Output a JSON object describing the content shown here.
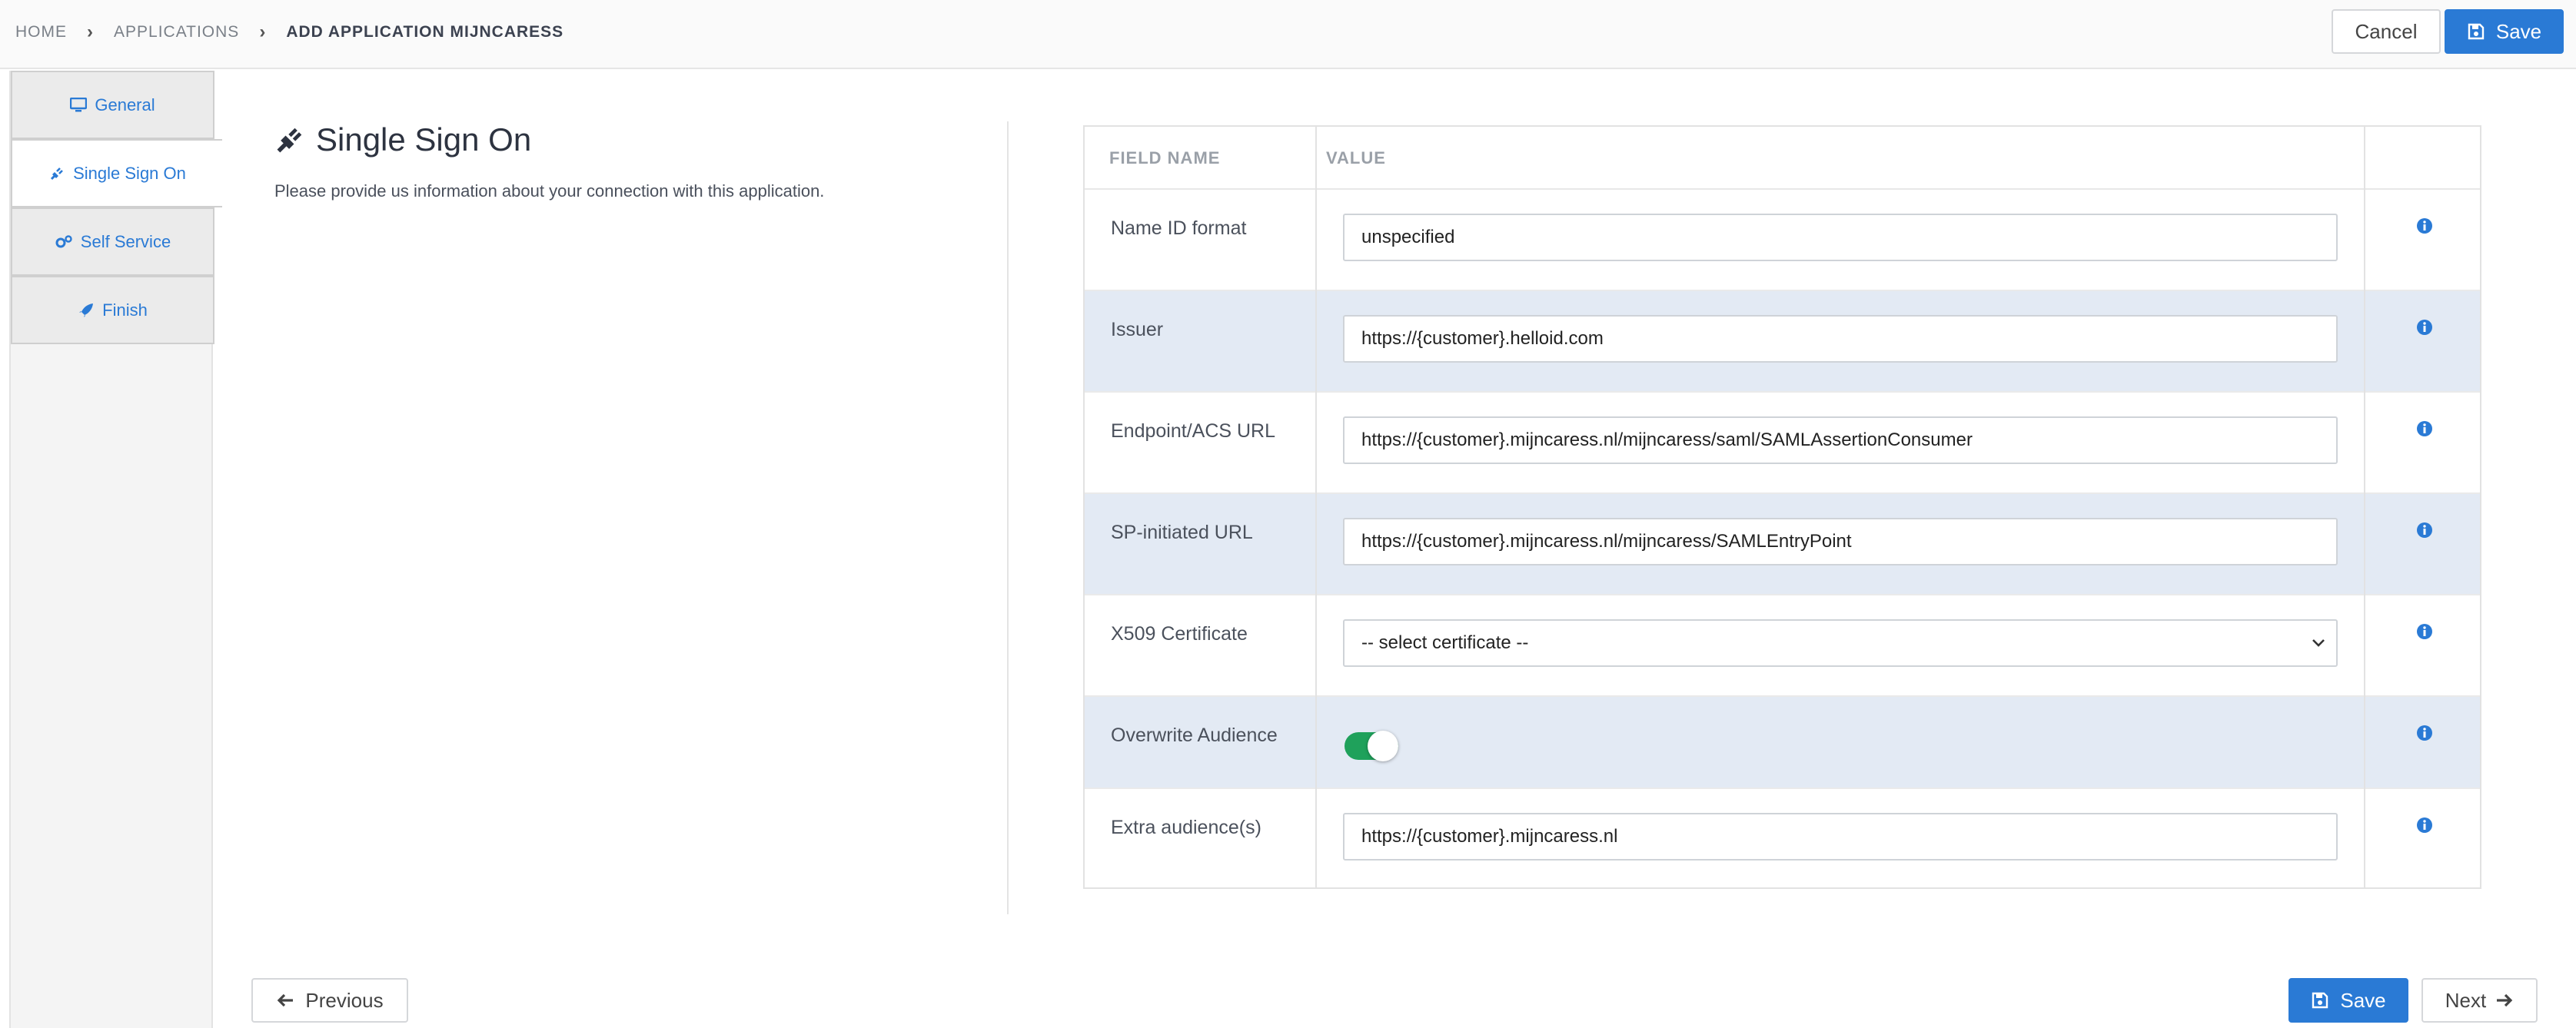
{
  "breadcrumb": {
    "items": [
      "HOME",
      "APPLICATIONS",
      "ADD APPLICATION MIJNCARESS"
    ]
  },
  "header": {
    "cancel_label": "Cancel",
    "save_label": "Save"
  },
  "steps": [
    {
      "label": "General",
      "icon": "monitor-icon",
      "active": false
    },
    {
      "label": "Single Sign On",
      "icon": "plug-icon",
      "active": true
    },
    {
      "label": "Self Service",
      "icon": "gears-icon",
      "active": false
    },
    {
      "label": "Finish",
      "icon": "rocket-icon",
      "active": false
    }
  ],
  "section": {
    "title": "Single Sign On",
    "subtitle": "Please provide us information about your connection with this application."
  },
  "table": {
    "col_field": "FIELD NAME",
    "col_value": "VALUE",
    "rows": [
      {
        "label": "Name ID format",
        "value": "unspecified",
        "type": "text"
      },
      {
        "label": "Issuer",
        "value": "https://{customer}.helloid.com",
        "type": "text"
      },
      {
        "label": "Endpoint/ACS URL",
        "value": "https://{customer}.mijncaress.nl/mijncaress/saml/SAMLAssertionConsumer",
        "type": "text"
      },
      {
        "label": "SP-initiated URL",
        "value": "https://{customer}.mijncaress.nl/mijncaress/SAMLEntryPoint",
        "type": "text"
      },
      {
        "label": "X509 Certificate",
        "value": "-- select certificate --",
        "type": "select"
      },
      {
        "label": "Overwrite Audience",
        "value": "on",
        "type": "toggle"
      },
      {
        "label": "Extra audience(s)",
        "value": "https://{customer}.mijncaress.nl",
        "type": "text"
      }
    ]
  },
  "footer": {
    "previous_label": "Previous",
    "save_label": "Save",
    "next_label": "Next"
  },
  "colors": {
    "primary": "#2a7ad5",
    "toggle_on": "#1fa15b",
    "row_alt": "#e3eaf4"
  }
}
